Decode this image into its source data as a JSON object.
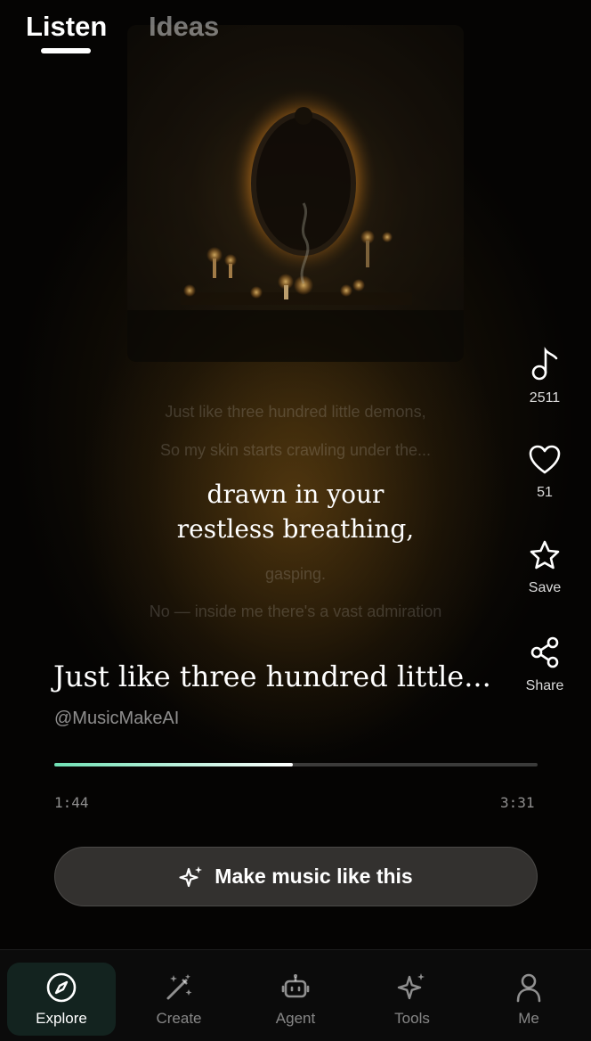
{
  "tabs": {
    "listen": "Listen",
    "ideas": "Ideas"
  },
  "lyrics": {
    "previous_1": "Just like three hundred little demons,",
    "previous_2": "So my skin starts crawling under the...",
    "current_line_1": "drawn in your",
    "current_line_2": "restless breathing,",
    "next_1": "gasping.",
    "next_2": "No — inside me there's a vast admiration"
  },
  "actions": {
    "plays": "2511",
    "likes": "51",
    "save": "Save",
    "share": "Share"
  },
  "song": {
    "title": "Just like three hundred little...",
    "author": "@MusicMakeAI"
  },
  "player": {
    "current_time": "1:44",
    "total_time": "3:31",
    "progress": 0.493
  },
  "cta": {
    "label": "Make music like this"
  },
  "bottom_nav": {
    "items": [
      {
        "label": "Explore",
        "icon": "compass-icon",
        "active": true
      },
      {
        "label": "Create",
        "icon": "magic-wand-icon",
        "active": false
      },
      {
        "label": "Agent",
        "icon": "robot-icon",
        "active": false
      },
      {
        "label": "Tools",
        "icon": "sparkles-icon",
        "active": false
      },
      {
        "label": "Me",
        "icon": "person-icon",
        "active": false
      }
    ]
  },
  "colors": {
    "accent": "#6fe0b4",
    "nav_active_bg": "#13231f",
    "glow": "#f2a83a"
  }
}
